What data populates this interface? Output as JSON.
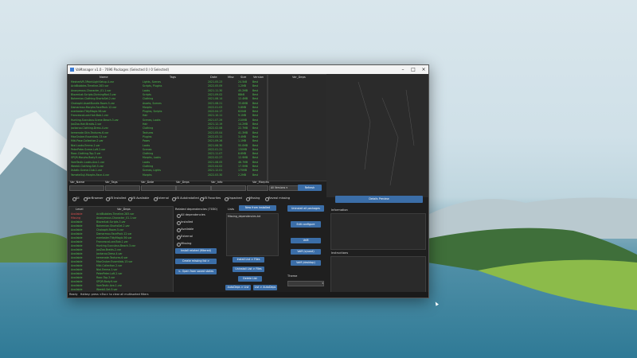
{
  "window": {
    "title": "VaManager v1.0 - 7696 Packages (Selected 0 / 0 Selected)"
  },
  "table_headers": {
    "name": "Name",
    "tags": "Tags",
    "date": "Date",
    "misc": "Misc",
    "size": "Size",
    "version": "Version",
    "var_deps": "Var_Deps"
  },
  "packages": [
    {
      "name": "MeshedVR.3PointLightSetup.4.var",
      "tags": "Lights, Scenes",
      "date": "2021.05.23",
      "size": "24.5kB",
      "ver": "Best"
    },
    {
      "name": "AcidBubbles.Timeline.283.var",
      "tags": "Scripts, Plugins",
      "date": "2022.05.09",
      "size": "1.2MB",
      "ver": "Best"
    },
    {
      "name": "Anonymous.Character_01.1.var",
      "tags": "Looks",
      "date": "2021.11.30",
      "size": "45.2MB",
      "ver": "Best"
    },
    {
      "name": "Blazedust.Scripts.DiviningRod.3.var",
      "tags": "Scripts",
      "date": "2021.09.02",
      "size": "88kB",
      "ver": "Best"
    },
    {
      "name": "Bohemian.Clothing.ShortsSet.2.var",
      "tags": "Clothing",
      "date": "2021.06.14",
      "size": "12.4MB",
      "ver": "Best"
    },
    {
      "name": "Chokaphi.AssetBundle.Room.5.var",
      "tags": "Assets, Scenes",
      "date": "2021.08.21",
      "size": "33.6MB",
      "ver": "Best"
    },
    {
      "name": "Damarmau.Morphs.FacePack.12.var",
      "tags": "Morphs",
      "date": "2022.01.03",
      "size": "5.8MB",
      "ver": "Best"
    },
    {
      "name": "everlaster.TittyMagic.56.var",
      "tags": "Plugins, Scripts",
      "date": "2022.04.17",
      "size": "620kB",
      "ver": "Best"
    },
    {
      "name": "FrancescaLuce.Hair.Bob.1.var",
      "tags": "Hair",
      "date": "2021.10.11",
      "size": "9.1MB",
      "ver": "Best"
    },
    {
      "name": "Hunting-Succubus.Scene.Beach.3.var",
      "tags": "Scenes, Looks",
      "date": "2021.07.29",
      "size": "210MB",
      "ver": "Best"
    },
    {
      "name": "JaxZoa.Hair.Braids.2.var",
      "tags": "Hair",
      "date": "2021.12.19",
      "size": "14.2MB",
      "ver": "Best"
    },
    {
      "name": "Jackaroo.Clothing.Dress.4.var",
      "tags": "Clothing",
      "date": "2022.02.08",
      "size": "22.7MB",
      "ver": "Best"
    },
    {
      "name": "kemenate.Skin.Textures.6.var",
      "tags": "Textures",
      "date": "2021.05.04",
      "size": "41.3MB",
      "ver": "Best"
    },
    {
      "name": "MacGruber.Essentials.13.var",
      "tags": "Plugins",
      "date": "2022.03.12",
      "size": "3.4MB",
      "ver": "Best"
    },
    {
      "name": "Miki.Pose.Collection.2.var",
      "tags": "Poses",
      "date": "2021.09.26",
      "size": "1.1MB",
      "ver": "Best"
    },
    {
      "name": "Nial.Looks.Emma.1.var",
      "tags": "Looks",
      "date": "2021.06.30",
      "size": "55.0MB",
      "ver": "Best"
    },
    {
      "name": "PeterPeter.Scene.Loft.2.var",
      "tags": "Scenes",
      "date": "2022.01.21",
      "size": "130MB",
      "ver": "Best"
    },
    {
      "name": "Roac.Clothing.Top.3.var",
      "tags": "Clothing",
      "date": "2021.11.07",
      "size": "8.6MB",
      "ver": "Best"
    },
    {
      "name": "SPQR.Morphs.Body.9.var",
      "tags": "Morphs, Looks",
      "date": "2022.02.27",
      "size": "12.9MB",
      "ver": "Best"
    },
    {
      "name": "VamTastic.Looks.Ava.1.var",
      "tags": "Looks",
      "date": "2021.08.05",
      "size": "48.7MB",
      "ver": "Best"
    },
    {
      "name": "WeebU.Clothing.Set.5.var",
      "tags": "Clothing",
      "date": "2022.04.02",
      "size": "17.5MB",
      "ver": "Best"
    },
    {
      "name": "Xstatic.Scene.Club.1.var",
      "tags": "Scenes, Lights",
      "date": "2021.12.01",
      "size": "175MB",
      "ver": "Best"
    },
    {
      "name": "YameteOuji.Morphs.Face.4.var",
      "tags": "Morphs",
      "date": "2022.03.30",
      "size": "2.2MB",
      "ver": "Best"
    }
  ],
  "filters": {
    "var_name": "Var_Name",
    "var_tags": "Var_Tags",
    "var_date": "Var_Date",
    "var_deps": "Var_Deps",
    "var_info": "Var_Info",
    "var_morphs": "Var_Morphs",
    "versions": "All Versions",
    "refresh": "Refresh"
  },
  "radios": [
    "All",
    "VarBrowser",
    "VB Installed",
    "VB Available",
    "External",
    "VB AutoInstalled",
    "VB Favorites",
    "Unpacked",
    "Missing",
    "Reveal missing"
  ],
  "details_btn": "Details Preview",
  "deps_headers": {
    "level": "Level",
    "var_deps": "Var_Deps"
  },
  "deps": [
    {
      "level": "Available",
      "name": "AcidBubbles.Timeline.283.var",
      "color": "#e05050"
    },
    {
      "level": "Missing",
      "name": "Anonymous.Character_01.1.var",
      "color": "#e05050"
    },
    {
      "level": "Available",
      "name": "Blazedust.Scripts.3.var",
      "color": "#4fc34f"
    },
    {
      "level": "Available",
      "name": "Bohemian.ShortsSet.2.var",
      "color": "#4fc34f"
    },
    {
      "level": "Available",
      "name": "Chokaphi.Room.5.var",
      "color": "#4fc34f"
    },
    {
      "level": "Available",
      "name": "Damarmau.FacePack.12.var",
      "color": "#4fc34f"
    },
    {
      "level": "Available",
      "name": "everlaster.TittyMagic.56.var",
      "color": "#4fc34f"
    },
    {
      "level": "Available",
      "name": "FrancescaLuce.Bob.1.var",
      "color": "#4fc34f"
    },
    {
      "level": "Available",
      "name": "Hunting-Succubus.Beach.3.var",
      "color": "#4fc34f"
    },
    {
      "level": "Available",
      "name": "JaxZoa.Braids.2.var",
      "color": "#4fc34f"
    },
    {
      "level": "Available",
      "name": "Jackaroo.Dress.4.var",
      "color": "#4fc34f"
    },
    {
      "level": "Available",
      "name": "kemenate.Textures.6.var",
      "color": "#4fc34f"
    },
    {
      "level": "Available",
      "name": "MacGruber.Essentials.13.var",
      "color": "#4fc34f"
    },
    {
      "level": "Available",
      "name": "Miki.Collection.2.var",
      "color": "#4fc34f"
    },
    {
      "level": "Available",
      "name": "Nial.Emma.1.var",
      "color": "#4fc34f"
    },
    {
      "level": "Available",
      "name": "PeterPeter.Loft.2.var",
      "color": "#4fc34f"
    },
    {
      "level": "Available",
      "name": "Roac.Top.3.var",
      "color": "#4fc34f"
    },
    {
      "level": "Available",
      "name": "SPQR.Body.9.var",
      "color": "#4fc34f"
    },
    {
      "level": "Available",
      "name": "VamTastic.Ava.1.var",
      "color": "#4fc34f"
    },
    {
      "level": "Available",
      "name": "WeebU.Set.5.var",
      "color": "#4fc34f"
    }
  ],
  "related": {
    "title": "Related dependencies (7030)",
    "options": [
      "All dependencies",
      "Installed",
      "Available",
      "External",
      "Missing"
    ],
    "btn_install": "Install related (filtered)",
    "btn_create": "Create missing list >",
    "btn_open": "<- Open from saved states"
  },
  "lists": {
    "label": "Lists",
    "new_from_installed": "New from installed",
    "item": "Missing_dependencies.txt",
    "install_list": "Install List > Files",
    "uninstall_list": "Uninstall List > Files",
    "delete_list": "Delete List",
    "autodeps": "AutoDeps > List",
    "list_autodeps": "List > AutoDeps"
  },
  "actions": {
    "uninstall_all": "Uninstall all packages",
    "edit_config": "Edit configure",
    "vaM": "VaM",
    "vaM_plus": "VaM (sysout)",
    "vaM_desktop": "VaM (desktop)"
  },
  "theme": {
    "label": "Theme",
    "value": ""
  },
  "info": {
    "information": "Information",
    "instructions": "Instructions"
  },
  "status": {
    "ready": "Ready",
    "hint": "Hotkey: press <Esc> to clear all multisorted filters"
  },
  "colors": {
    "green": "#4fc34f",
    "red": "#e05050",
    "button": "#3b6ea8",
    "panel": "#2a2a2a"
  }
}
